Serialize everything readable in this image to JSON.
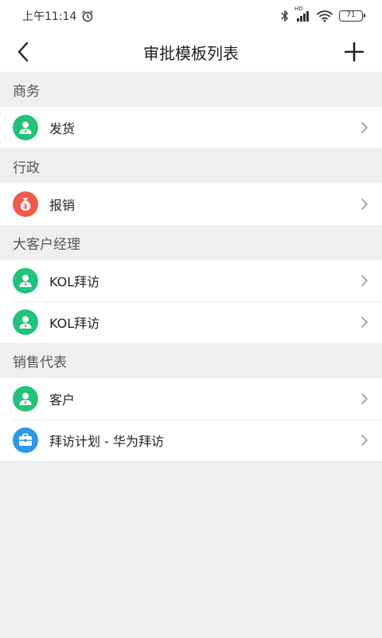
{
  "status_bar": {
    "time": "上午11:14",
    "battery": "71",
    "network_label": "HD"
  },
  "nav": {
    "title": "审批模板列表"
  },
  "colors": {
    "green": "#21c27a",
    "red": "#ef5a4b",
    "blue": "#2b9ae6"
  },
  "sections": [
    {
      "header": "商务",
      "items": [
        {
          "label": "发货",
          "icon": "person-icon",
          "color": "green"
        }
      ]
    },
    {
      "header": "行政",
      "items": [
        {
          "label": "报销",
          "icon": "money-bag-icon",
          "color": "red"
        }
      ]
    },
    {
      "header": "大客户经理",
      "items": [
        {
          "label": "KOL拜访",
          "icon": "person-icon",
          "color": "green"
        },
        {
          "label": "KOL拜访",
          "icon": "person-icon",
          "color": "green"
        }
      ]
    },
    {
      "header": "销售代表",
      "items": [
        {
          "label": "客户",
          "icon": "person-icon",
          "color": "green"
        },
        {
          "label": "拜访计划 - 华为拜访",
          "icon": "briefcase-icon",
          "color": "blue"
        }
      ]
    }
  ]
}
